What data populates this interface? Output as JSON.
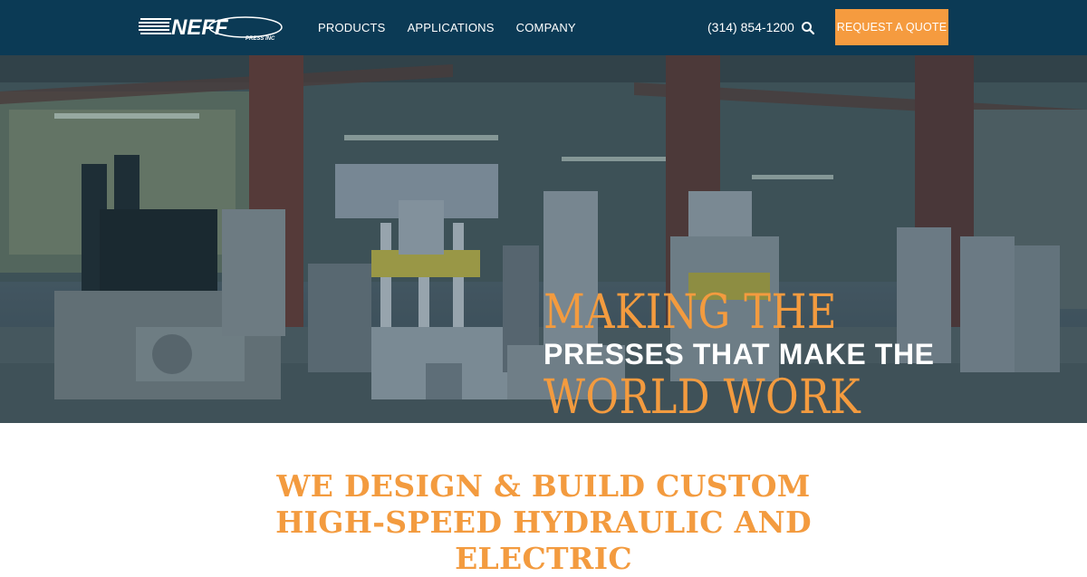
{
  "header": {
    "logo_text": "NEFF",
    "logo_subtext": "PRESS INC",
    "nav": [
      {
        "label": "PRODUCTS"
      },
      {
        "label": "APPLICATIONS"
      },
      {
        "label": "COMPANY"
      }
    ],
    "phone": "(314) 854-1200",
    "search_icon": "search-icon",
    "quote_button": "REQUEST A QUOTE"
  },
  "hero": {
    "line1": "MAKING THE",
    "line2": "PRESSES THAT MAKE THE",
    "line3": "WORLD WORK"
  },
  "intro": {
    "heading": "WE DESIGN & BUILD CUSTOM HIGH-SPEED HYDRAULIC AND ELECTRIC"
  },
  "colors": {
    "header_bg": "#0b3a55",
    "accent": "#f39b3f",
    "button_bg": "#f59b3f"
  }
}
